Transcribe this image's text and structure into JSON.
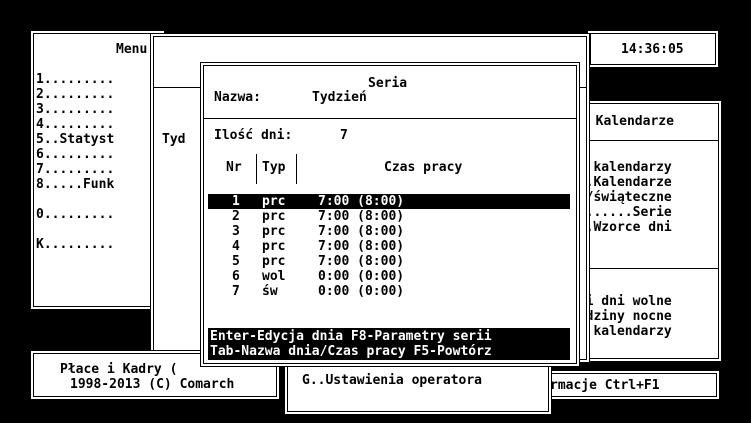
{
  "clock": "14:36:05",
  "menu": {
    "title": "Menu",
    "items": [
      "1.........",
      "2.........",
      "3.........",
      "4.........",
      "5..Statyst",
      "6.........",
      "7.........",
      "8.....Funk",
      "0.........",
      "K........."
    ]
  },
  "tydzien_label": "Tyd",
  "kalendarze": {
    "title": "- Kalendarze",
    "items": [
      "ry kalendarzy",
      "...Kalendarze",
      "ne/świąteczne",
      "........Serie",
      "...Wzorce dni"
    ],
    "items2": [
      "a i dni wolne",
      "Godziny nocne",
      "ia kalendarzy"
    ]
  },
  "footer": {
    "app": "Płace i Kadry (",
    "copyright": "1998-2013 (C) Comarch",
    "settings": "G..Ustawienia operatora",
    "info": "rmacje Ctrl+F1"
  },
  "dialog": {
    "title": "Seria",
    "name_label": "Nazwa:",
    "name_value": "Tydzień",
    "days_label": "Ilość dni:",
    "days_value": "7",
    "col_nr": "Nr",
    "col_typ": "Typ",
    "col_czas": "Czas pracy",
    "rows": [
      {
        "nr": "1",
        "typ": "prc",
        "czas": "7:00 (8:00)"
      },
      {
        "nr": "2",
        "typ": "prc",
        "czas": "7:00 (8:00)"
      },
      {
        "nr": "3",
        "typ": "prc",
        "czas": "7:00 (8:00)"
      },
      {
        "nr": "4",
        "typ": "prc",
        "czas": "7:00 (8:00)"
      },
      {
        "nr": "5",
        "typ": "prc",
        "czas": "7:00 (8:00)"
      },
      {
        "nr": "6",
        "typ": "wol",
        "czas": "0:00 (0:00)"
      },
      {
        "nr": "7",
        "typ": "św",
        "czas": "0:00 (0:00)"
      }
    ],
    "hint1": "Enter-Edycja dnia F8-Parametry serii",
    "hint2": "Tab-Nazwa dnia/Czas pracy F5-Powtórz"
  }
}
